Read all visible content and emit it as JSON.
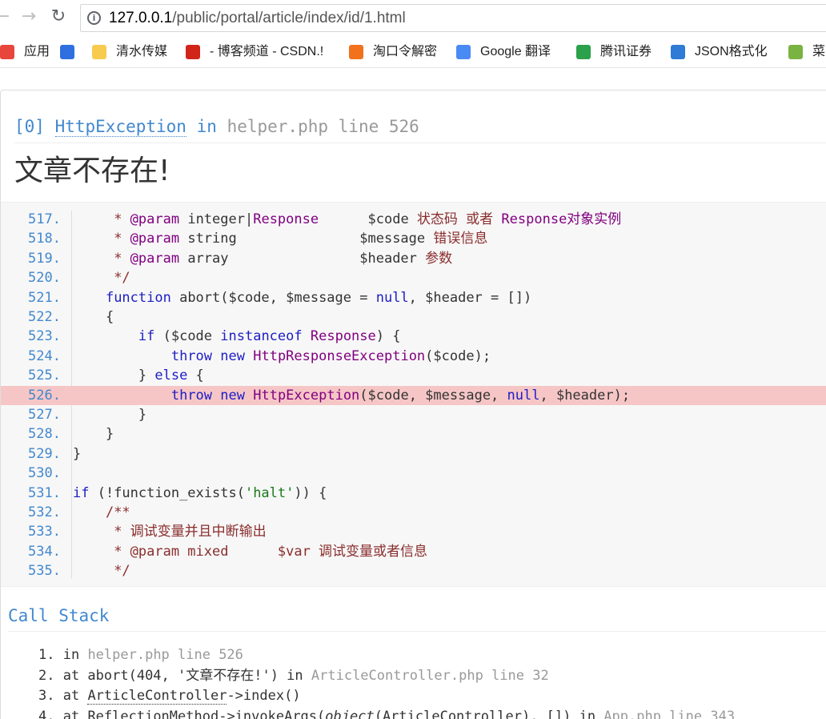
{
  "browser": {
    "url_host": "127.0.0.1",
    "url_path": "/public/portal/article/index/id/1.html",
    "bookmarks": [
      {
        "label": "应用",
        "color": "#e8453c"
      },
      {
        "label": "",
        "color": "#2f6fdf"
      },
      {
        "label": "清水传媒",
        "color": "#f7cb4d"
      },
      {
        "label": "- 博客频道 - CSDN.!",
        "color": "#d1251a"
      },
      {
        "label": "淘口令解密",
        "color": "#f2711c"
      },
      {
        "label": "Google 翻译",
        "color": "#4a8af4"
      },
      {
        "label": "腾讯证券",
        "color": "#2aa14a"
      },
      {
        "label": "JSON格式化",
        "color": "#2f7bd5"
      },
      {
        "label": "菜",
        "color": "#7bb342"
      }
    ]
  },
  "exception": {
    "index": "[0]",
    "class_name": "HttpException",
    "in_text": "in",
    "location": "helper.php line 526",
    "message": "文章不存在!"
  },
  "source": {
    "lines": [
      {
        "n": "517.",
        "html": "     <span class=\"cm\">* </span><span class=\"ty\">@param</span> integer|<span class=\"ty\">Response</span>      $code <span class=\"cm\">状态码 或者 </span><span class=\"ty\">Response对象实例</span>"
      },
      {
        "n": "518.",
        "html": "     <span class=\"cm\">* </span><span class=\"ty\">@param</span> string               $message <span class=\"cm\">错误信息</span>"
      },
      {
        "n": "519.",
        "html": "     <span class=\"cm\">* </span><span class=\"ty\">@param</span> array                $header <span class=\"cm\">参数</span>"
      },
      {
        "n": "520.",
        "html": "     <span class=\"cm\">*/</span>"
      },
      {
        "n": "521.",
        "html": "    <span class=\"t-kw\">function</span> abort($code, $message = <span class=\"t-kw\">null</span>, $header = [])"
      },
      {
        "n": "522.",
        "html": "    {"
      },
      {
        "n": "523.",
        "html": "        <span class=\"t-kw\">if</span> ($code <span class=\"t-kw\">instanceof</span> <span class=\"ty\">Response</span>) {"
      },
      {
        "n": "524.",
        "html": "            <span class=\"t-kw\">throw</span> <span class=\"t-kw\">new</span> <span class=\"ty\">HttpResponseException</span>($code);"
      },
      {
        "n": "525.",
        "html": "        } <span class=\"t-kw\">else</span> {"
      },
      {
        "n": "526.",
        "html": "            <span class=\"t-kw\">throw</span> <span class=\"t-kw\">new</span> <span class=\"ty\">HttpException</span>($code, $message, <span class=\"t-kw\">null</span>, $header);",
        "highlight": true
      },
      {
        "n": "527.",
        "html": "        }"
      },
      {
        "n": "528.",
        "html": "    }"
      },
      {
        "n": "529.",
        "html": "}"
      },
      {
        "n": "530.",
        "html": ""
      },
      {
        "n": "531.",
        "html": "<span class=\"t-kw\">if</span> (!function_exists(<span class=\"st\">'halt'</span>)) {"
      },
      {
        "n": "532.",
        "html": "    <span class=\"cm\">/**</span>"
      },
      {
        "n": "533.",
        "html": "     <span class=\"cm\">* 调试变量并且中断输出</span>"
      },
      {
        "n": "534.",
        "html": "     <span class=\"cm\">* @param mixed      $var 调试变量或者信息</span>"
      },
      {
        "n": "535.",
        "html": "     <span class=\"cm\">*/</span>"
      }
    ]
  },
  "call_stack": {
    "title": "Call Stack",
    "items": [
      {
        "num": "1.",
        "html": "in <span class=\"gray\">helper.php line 526</span>"
      },
      {
        "num": "2.",
        "html": "at abort(404, '文章不存在!') in <span class=\"gray\">ArticleController.php line 32</span>"
      },
      {
        "num": "3.",
        "html": "at <span class=\"dotted\">ArticleController</span>-&gt;index()"
      },
      {
        "num": "4.",
        "html": "at <span class=\"dotted\">ReflectionMethod</span>-&gt;invokeArgs(<em>object</em>(<span class=\"dotted\">ArticleController</span>), []) in <span class=\"gray\">App.php line 343</span>"
      }
    ]
  },
  "colors": {
    "link_blue": "#4288ce",
    "highlight_row": "#f6c6c6",
    "code_bg": "#f7f7f7"
  }
}
